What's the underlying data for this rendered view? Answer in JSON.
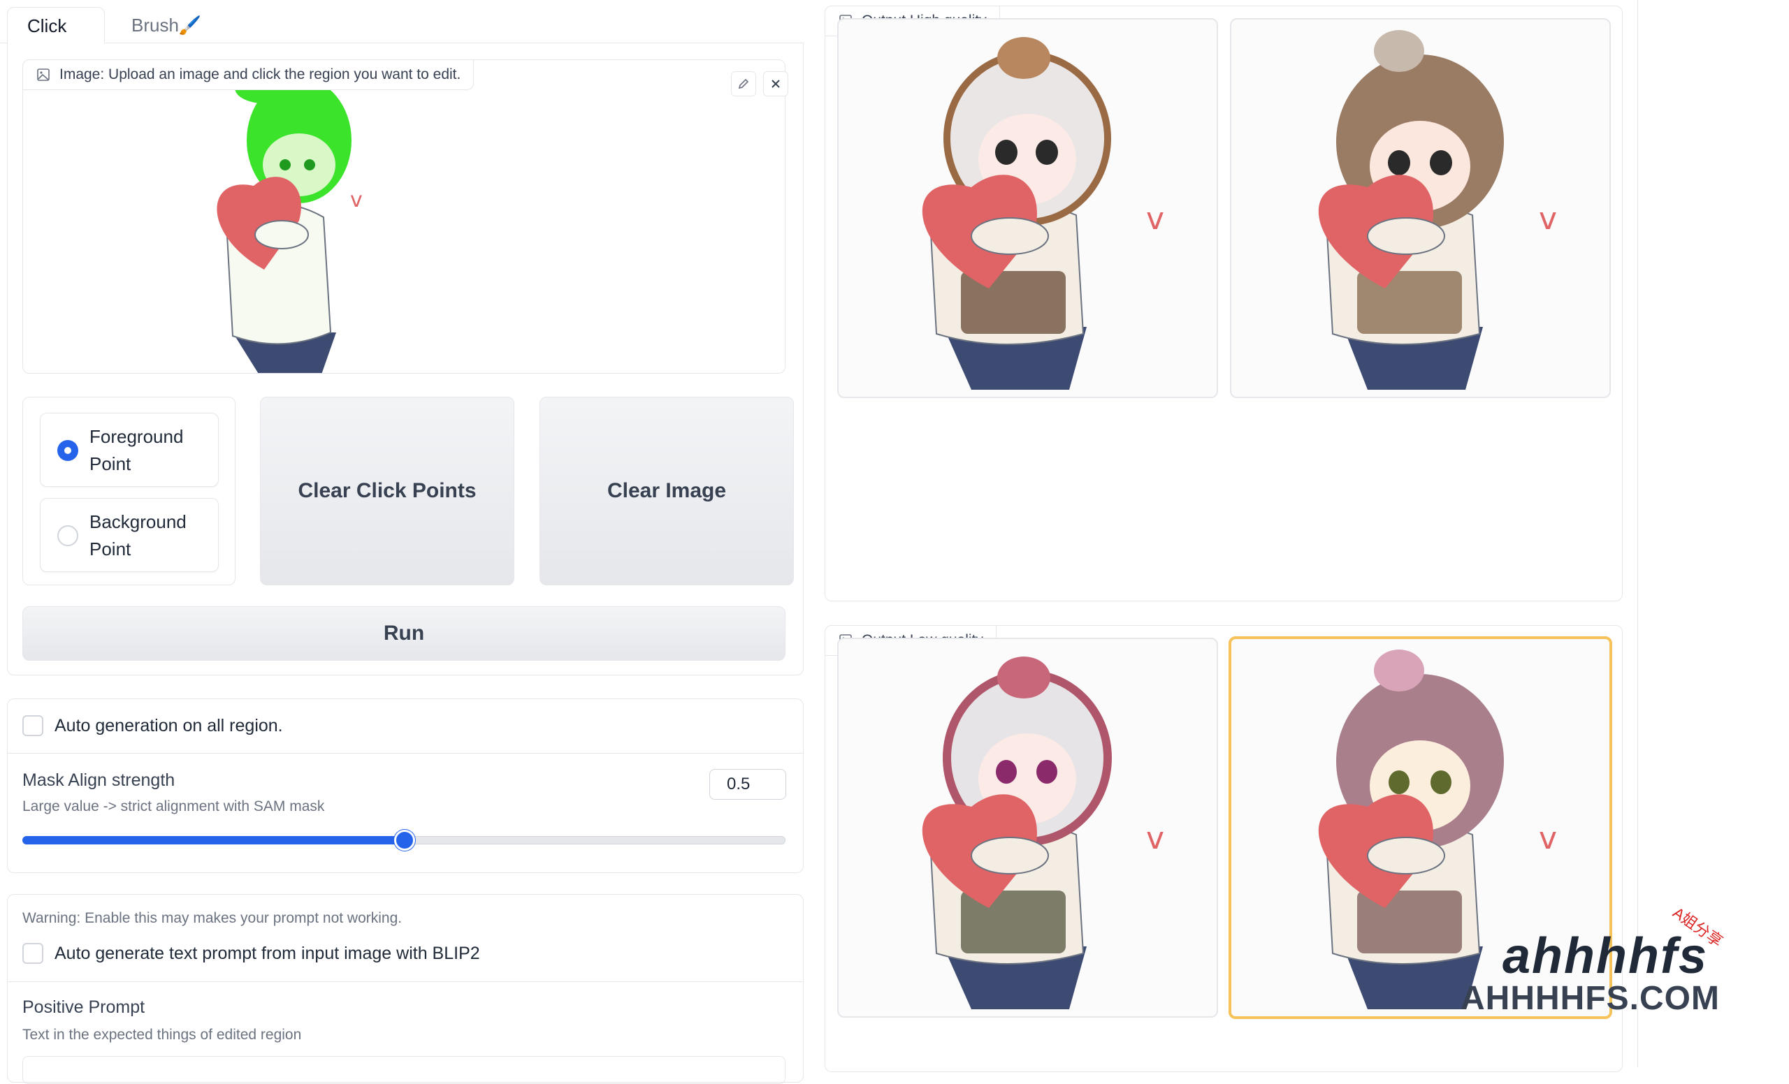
{
  "tabs": [
    {
      "label": "Click"
    },
    {
      "label": "Brush🖌️"
    }
  ],
  "input_image": {
    "label": "Image: Upload an image and click the region you want to edit."
  },
  "point_type": {
    "options": [
      {
        "label": "Foreground Point",
        "checked": true
      },
      {
        "label": "Background Point",
        "checked": false
      }
    ]
  },
  "buttons": {
    "clear_click_points": "Clear Click Points",
    "clear_image": "Clear Image",
    "run": "Run"
  },
  "auto_generation": {
    "label": "Auto generation on all region.",
    "checked": false
  },
  "mask_align": {
    "label": "Mask Align strength",
    "info": "Large value -> strict alignment with SAM mask",
    "value": "0.5",
    "fraction": 0.5
  },
  "blip": {
    "warning": "Warning: Enable this may makes your prompt not working.",
    "label": "Auto generate text prompt from input image with BLIP2",
    "checked": false
  },
  "positive_prompt": {
    "label": "Positive Prompt",
    "info": "Text in the expected things of edited region"
  },
  "outputs": {
    "high_quality_label": "Output High quality",
    "low_quality_label": "Output Low quality"
  },
  "watermark": {
    "top": "ahhhhfs",
    "bottom": "AHHHHFS.COM",
    "cn": "A姐分享"
  },
  "colors": {
    "accent": "#2563eb",
    "selected_border": "#f6c35a",
    "mask_green": "#3be32b",
    "heart": "#e06466"
  }
}
